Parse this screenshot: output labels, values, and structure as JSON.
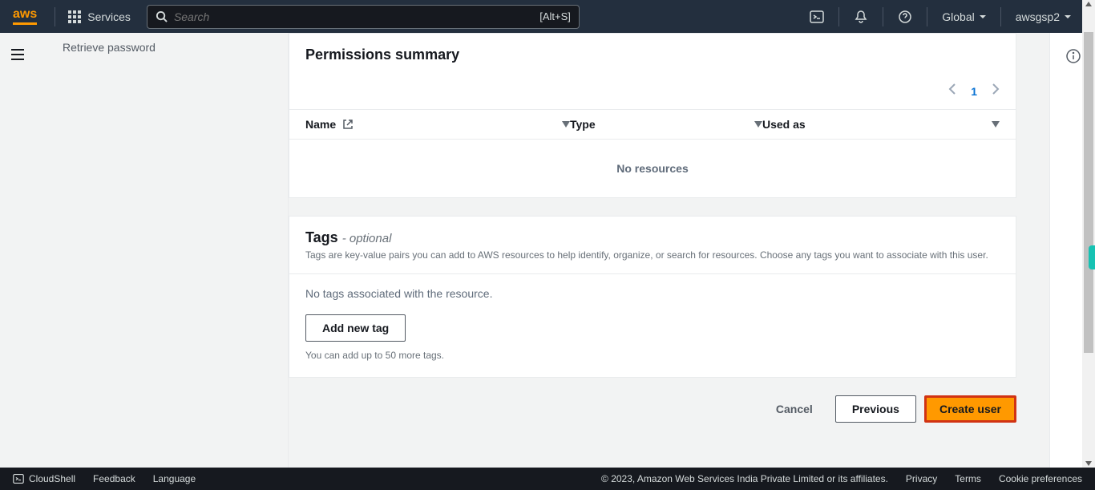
{
  "nav": {
    "logo": "aws",
    "services": "Services",
    "search_placeholder": "Search",
    "search_shortcut": "[Alt+S]",
    "region": "Global",
    "account": "awsgsp2"
  },
  "left": {
    "retrieve_password": "Retrieve password"
  },
  "permissions": {
    "title": "Permissions summary",
    "page": "1",
    "columns": {
      "name": "Name",
      "type": "Type",
      "used_as": "Used as"
    },
    "empty": "No resources"
  },
  "tags": {
    "title": "Tags",
    "optional": "- optional",
    "subtitle": "Tags are key-value pairs you can add to AWS resources to help identify, organize, or search for resources. Choose any tags you want to associate with this user.",
    "empty": "No tags associated with the resource.",
    "add_button": "Add new tag",
    "helper": "You can add up to 50 more tags."
  },
  "actions": {
    "cancel": "Cancel",
    "previous": "Previous",
    "create": "Create user"
  },
  "footer": {
    "cloudshell": "CloudShell",
    "feedback": "Feedback",
    "language": "Language",
    "copyright": "© 2023, Amazon Web Services India Private Limited or its affiliates.",
    "privacy": "Privacy",
    "terms": "Terms",
    "cookie": "Cookie preferences"
  }
}
